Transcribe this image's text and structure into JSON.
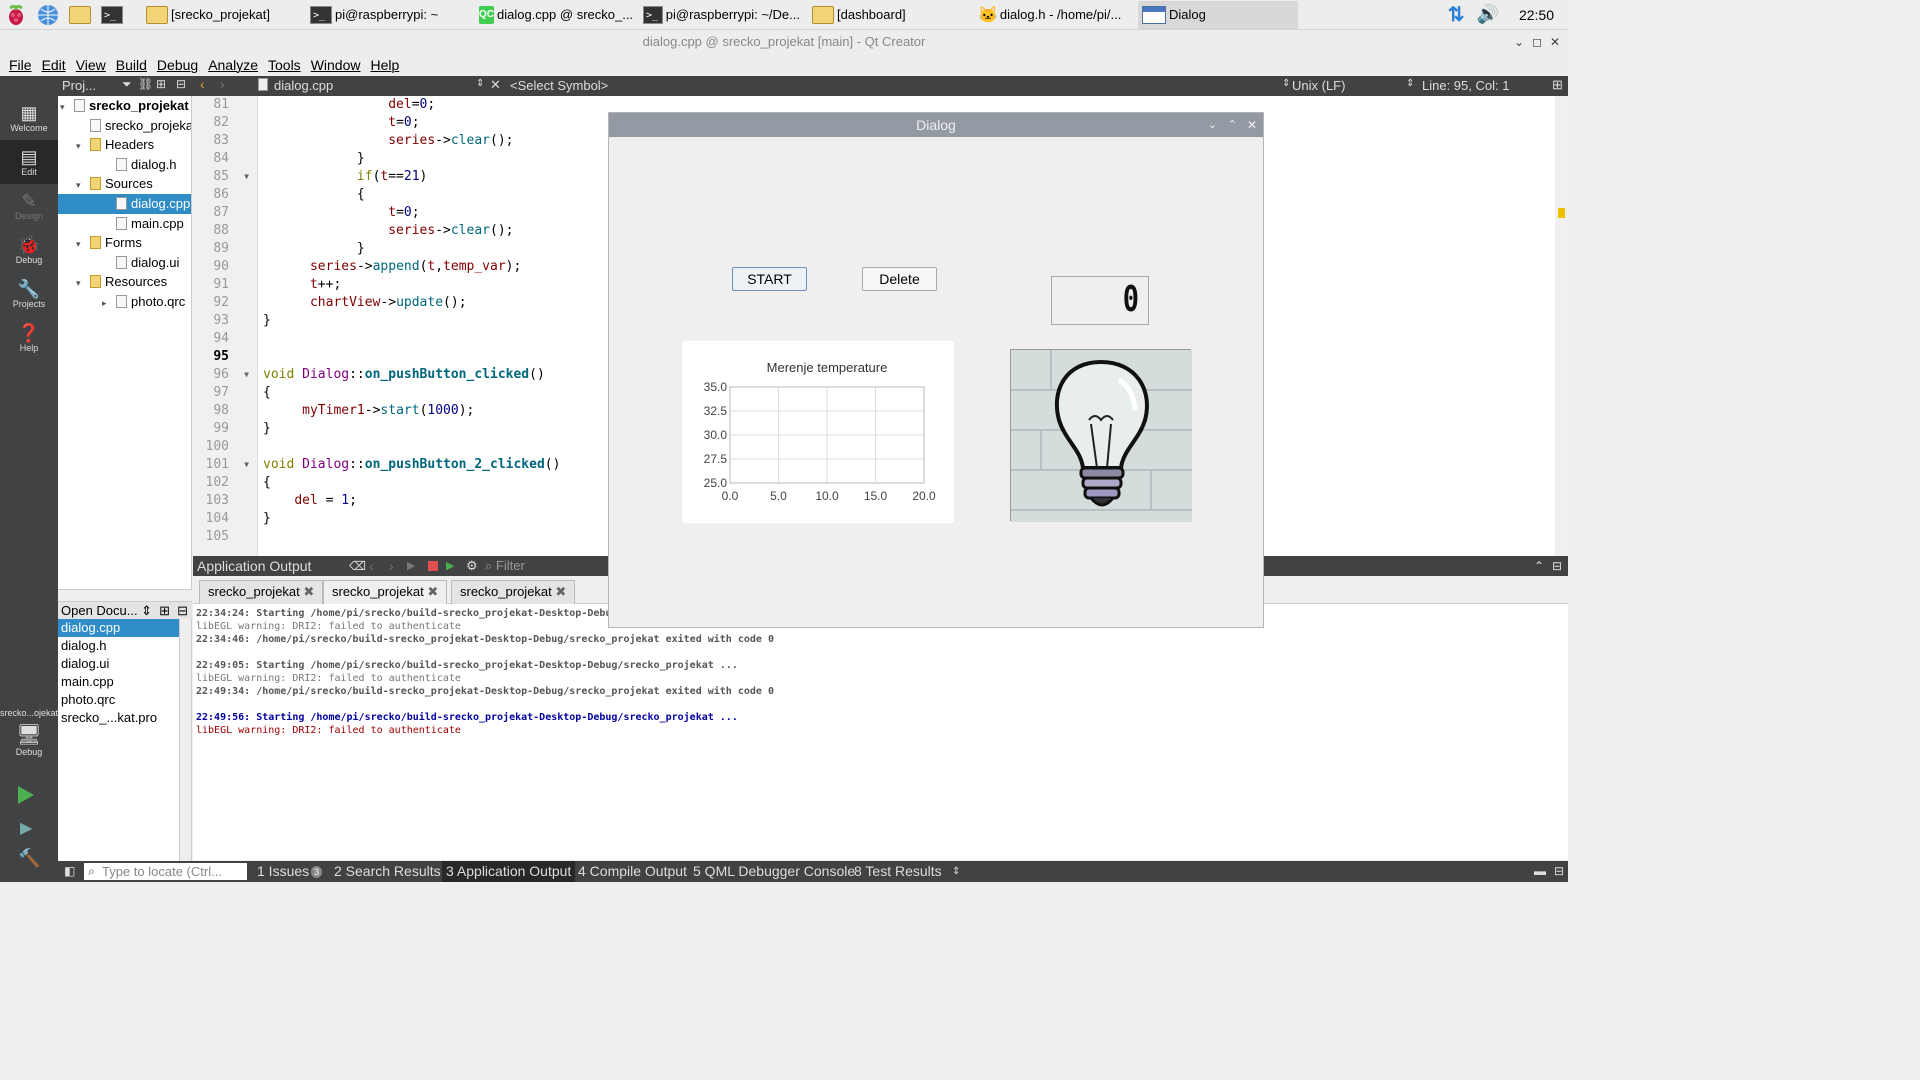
{
  "taskbar": {
    "tasks": [
      "[srecko_projekat]",
      "pi@raspberrypi: ~",
      "dialog.cpp @ srecko_...",
      "pi@raspberrypi: ~/De...",
      "[dashboard]",
      "dialog.h - /home/pi/...",
      "Dialog"
    ],
    "clock": "22:50"
  },
  "window": {
    "title": "dialog.cpp @ srecko_projekat [main] - Qt Creator"
  },
  "menu": [
    "File",
    "Edit",
    "View",
    "Build",
    "Debug",
    "Analyze",
    "Tools",
    "Window",
    "Help"
  ],
  "modes": [
    "Welcome",
    "Edit",
    "Design",
    "Debug",
    "Projects",
    "Help"
  ],
  "kit": {
    "name": "srecko...ojekat",
    "mode": "Debug"
  },
  "toolbar": {
    "proj_label": "Proj...",
    "file": "dialog.cpp",
    "symbol": "<Select Symbol>",
    "line_ending": "Unix (LF)",
    "position": "Line: 95, Col: 1"
  },
  "project_tree": [
    {
      "label": "srecko_projekat [",
      "level": 0,
      "bold": true
    },
    {
      "label": "srecko_projeka",
      "level": 1
    },
    {
      "label": "Headers",
      "level": 1,
      "folder": true
    },
    {
      "label": "dialog.h",
      "level": 2
    },
    {
      "label": "Sources",
      "level": 1,
      "folder": true
    },
    {
      "label": "dialog.cpp",
      "level": 2,
      "selected": true
    },
    {
      "label": "main.cpp",
      "level": 2
    },
    {
      "label": "Forms",
      "level": 1,
      "folder": true
    },
    {
      "label": "dialog.ui",
      "level": 2
    },
    {
      "label": "Resources",
      "level": 1,
      "folder": true
    },
    {
      "label": "photo.qrc",
      "level": 2
    }
  ],
  "open_documents": {
    "title": "Open Docu...",
    "items": [
      "dialog.cpp",
      "dialog.h",
      "dialog.ui",
      "main.cpp",
      "photo.qrc",
      "srecko_...kat.pro"
    ]
  },
  "code": {
    "line_numbers": [
      "81",
      "82",
      "83",
      "84",
      "85",
      "86",
      "87",
      "88",
      "89",
      "90",
      "91",
      "92",
      "93",
      "94",
      "95",
      "96",
      "97",
      "98",
      "99",
      "100",
      "101",
      "102",
      "103",
      "104",
      "105"
    ],
    "lines": [
      "                del=0;",
      "                t=0;",
      "                series->clear();",
      "            }",
      "            if(t==21)",
      "            {",
      "                t=0;",
      "                series->clear();",
      "            }",
      "      series->append(t,temp_var);",
      "      t++;",
      "      chartView->update();",
      "}",
      "",
      "",
      "void Dialog::on_pushButton_clicked()",
      "{",
      "     myTimer1->start(1000);",
      "}",
      "",
      "void Dialog::on_pushButton_2_clicked()",
      "{",
      "    del = 1;",
      "}",
      ""
    ]
  },
  "output_pane": {
    "title": "Application Output",
    "filter_placeholder": "Filter",
    "tabs": [
      "srecko_projekat",
      "srecko_projekat",
      "srecko_projekat"
    ],
    "lines": [
      {
        "text": "22:34:24: Starting /home/pi/srecko/build-srecko_projekat-Desktop-Debug/srecko_projekat ...",
        "kind": "info"
      },
      {
        "text": "libEGL warning: DRI2: failed to authenticate",
        "kind": "warn"
      },
      {
        "text": "22:34:46: /home/pi/srecko/build-srecko_projekat-Desktop-Debug/srecko_projekat exited with code 0",
        "kind": "info"
      },
      {
        "text": "",
        "kind": "info"
      },
      {
        "text": "22:49:05: Starting /home/pi/srecko/build-srecko_projekat-Desktop-Debug/srecko_projekat ...",
        "kind": "info"
      },
      {
        "text": "libEGL warning: DRI2: failed to authenticate",
        "kind": "warn"
      },
      {
        "text": "22:49:34: /home/pi/srecko/build-srecko_projekat-Desktop-Debug/srecko_projekat exited with code 0",
        "kind": "info"
      },
      {
        "text": "",
        "kind": "info"
      },
      {
        "text": "22:49:56: Starting /home/pi/srecko/build-srecko_projekat-Desktop-Debug/srecko_projekat ...",
        "kind": "blue"
      },
      {
        "text": "libEGL warning: DRI2: failed to authenticate",
        "kind": "red"
      }
    ]
  },
  "statusbar": {
    "locate_placeholder": "Type to locate (Ctrl...",
    "tabs": [
      "1 Issues",
      "2 Search Results",
      "3 Application Output",
      "4 Compile Output",
      "5 QML Debugger Console",
      "8 Test Results"
    ],
    "issues_count": "3"
  },
  "dialog": {
    "title": "Dialog",
    "start_label": "START",
    "delete_label": "Delete",
    "lcd_value": "0"
  },
  "chart_data": {
    "type": "line",
    "title": "Merenje temperature",
    "xlim": [
      0,
      20
    ],
    "ylim": [
      25,
      35
    ],
    "x_ticks": [
      "0.0",
      "5.0",
      "10.0",
      "15.0",
      "20.0"
    ],
    "y_ticks": [
      "35.0",
      "32.5",
      "30.0",
      "27.5",
      "25.0"
    ],
    "series": [
      {
        "x": [],
        "y": []
      }
    ],
    "grid": true
  }
}
